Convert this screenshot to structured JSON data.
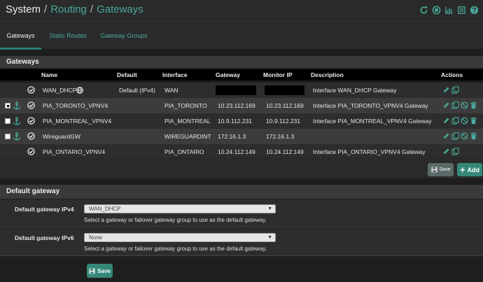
{
  "breadcrumb": {
    "root": "System",
    "sep": "/",
    "items": [
      "Routing",
      "Gateways"
    ]
  },
  "header_icons": [
    "refresh-icon",
    "stop-icon",
    "chart-icon",
    "list-icon",
    "help-icon"
  ],
  "tabs": [
    {
      "label": "Gateways",
      "active": true
    },
    {
      "label": "Static Routes",
      "active": false
    },
    {
      "label": "Gateway Groups",
      "active": false
    }
  ],
  "panel_title": "Gateways",
  "table": {
    "headers": [
      "Name",
      "Default",
      "Interface",
      "Gateway",
      "Monitor IP",
      "Description",
      "Actions"
    ],
    "rows": [
      {
        "checkbox": false,
        "checked": false,
        "anchor": false,
        "name": "WAN_DHCP",
        "globe": true,
        "default": "Default (IPv4)",
        "interface": "WAN",
        "gateway": "",
        "monitor": "",
        "redacted": true,
        "description": "Interface WAN_DHCP Gateway",
        "actions": [
          "edit",
          "copy"
        ]
      },
      {
        "checkbox": true,
        "checked": true,
        "anchor": true,
        "name": "PIA_TORONTO_VPNV4",
        "globe": false,
        "default": "",
        "interface": "PIA_TORONTO",
        "gateway": "10.23.112.169",
        "monitor": "10.23.112.169",
        "redacted": false,
        "description": "Interface PIA_TORONTO_VPNV4 Gateway",
        "actions": [
          "edit",
          "copy",
          "disable",
          "delete"
        ]
      },
      {
        "checkbox": true,
        "checked": false,
        "anchor": true,
        "name": "PIA_MONTREAL_VPNV4",
        "globe": false,
        "default": "",
        "interface": "PIA_MONTREAL",
        "gateway": "10.9.112.231",
        "monitor": "10.9.112.231",
        "redacted": false,
        "description": "Interface PIA_MONTREAL_VPNV4 Gateway",
        "actions": [
          "edit",
          "copy",
          "disable",
          "delete"
        ]
      },
      {
        "checkbox": true,
        "checked": false,
        "anchor": true,
        "name": "WireguardGW",
        "globe": false,
        "default": "",
        "interface": "WIREGUARDINT",
        "gateway": "172.16.1.3",
        "monitor": "172.16.1.3",
        "redacted": false,
        "description": "",
        "actions": [
          "edit",
          "copy",
          "disable",
          "delete"
        ]
      },
      {
        "checkbox": false,
        "checked": false,
        "anchor": false,
        "name": "PIA_ONTARIO_VPNV4",
        "globe": false,
        "default": "",
        "interface": "PIA_ONTARIO",
        "gateway": "10.24.112.149",
        "monitor": "10.24.112.149",
        "redacted": false,
        "description": "Interface PIA_ONTARIO_VPNV4 Gateway",
        "actions": [
          "edit",
          "copy"
        ]
      }
    ]
  },
  "buttons": {
    "save_small": "Save",
    "add": "Add",
    "save": "Save"
  },
  "default_gateway": {
    "title": "Default gateway",
    "ipv4": {
      "label": "Default gateway IPv4",
      "value": "WAN_DHCP",
      "help": "Select a gateway or failover gateway group to use as the default gateway."
    },
    "ipv6": {
      "label": "Default gateway IPv6",
      "value": "None",
      "help": "Select a gateway or failover gateway group to use as the default gateway."
    }
  },
  "colors": {
    "accent": "#48a89a",
    "button": "#348878",
    "background": "#1e1e1e"
  }
}
